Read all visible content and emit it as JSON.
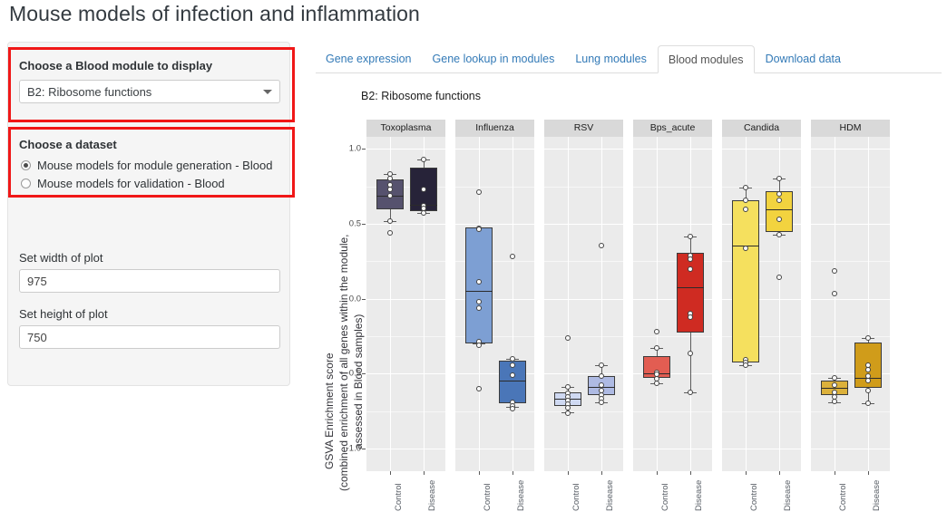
{
  "page": {
    "title": "Mouse models of infection and inflammation"
  },
  "sidebar": {
    "module_label": "Choose a Blood module to display",
    "module_selected": "B2: Ribosome functions",
    "dataset_label": "Choose a dataset",
    "dataset_options": [
      {
        "label": "Mouse models for module generation - Blood",
        "checked": true
      },
      {
        "label": "Mouse models for validation - Blood",
        "checked": false
      }
    ],
    "width_label": "Set width of plot",
    "width_value": "975",
    "height_label": "Set height of plot",
    "height_value": "750",
    "highlight_color": "#f01717"
  },
  "tabs": [
    {
      "label": "Gene expression",
      "active": false
    },
    {
      "label": "Gene lookup in modules",
      "active": false
    },
    {
      "label": "Lung modules",
      "active": false
    },
    {
      "label": "Blood modules",
      "active": true
    },
    {
      "label": "Download data",
      "active": false
    }
  ],
  "chart_data": {
    "type": "box",
    "title": "B2: Ribosome functions",
    "ylabel": "GSVA Enrichment score",
    "ylabel2": "(combined enrichment of all genes within the module,",
    "ylabel3": "assessed in Blood samples)",
    "xlabel": "",
    "ylim": [
      -1.15,
      1.08
    ],
    "yticks": [
      1.0,
      0.5,
      0.0,
      -0.5,
      -1.0
    ],
    "ytick_labels": [
      "1.0",
      "0.5",
      "0.0",
      "-0.5",
      "-1.0"
    ],
    "grid": true,
    "legend": "none",
    "groups": [
      "Control",
      "Disease"
    ],
    "panels": [
      {
        "name": "Toxoplasma",
        "boxes": [
          {
            "group": "Control",
            "fill": "#56526e",
            "q1": 0.595,
            "median": 0.685,
            "q3": 0.795,
            "lower_whisker": 0.52,
            "upper_whisker": 0.83,
            "points": [
              0.83,
              0.8,
              0.76,
              0.73,
              0.685,
              0.52,
              0.44
            ]
          },
          {
            "group": "Disease",
            "fill": "#272339",
            "q1": 0.585,
            "median": 0.625,
            "q3": 0.875,
            "lower_whisker": 0.57,
            "upper_whisker": 0.93,
            "points": [
              0.93,
              0.73,
              0.62,
              0.6,
              0.57
            ]
          }
        ]
      },
      {
        "name": "Influenza",
        "boxes": [
          {
            "group": "Control",
            "fill": "#7d9fd3",
            "q1": -0.295,
            "median": 0.055,
            "q3": 0.475,
            "lower_whisker": -0.3,
            "upper_whisker": 0.475,
            "points": [
              0.71,
              0.47,
              0.465,
              0.115,
              -0.02,
              -0.06,
              -0.285,
              -0.31,
              -0.6
            ]
          },
          {
            "group": "Disease",
            "fill": "#4a76b8",
            "q1": -0.695,
            "median": -0.545,
            "q3": -0.415,
            "lower_whisker": -0.72,
            "upper_whisker": -0.4,
            "points": [
              0.285,
              -0.4,
              -0.44,
              -0.51,
              -0.69,
              -0.715,
              -0.73
            ]
          }
        ]
      },
      {
        "name": "RSV",
        "boxes": [
          {
            "group": "Control",
            "fill": "#cfd9f2",
            "q1": -0.715,
            "median": -0.665,
            "q3": -0.625,
            "lower_whisker": -0.76,
            "upper_whisker": -0.59,
            "points": [
              -0.26,
              -0.59,
              -0.63,
              -0.655,
              -0.68,
              -0.7,
              -0.725,
              -0.765
            ]
          },
          {
            "group": "Disease",
            "fill": "#aebae3",
            "q1": -0.645,
            "median": -0.585,
            "q3": -0.515,
            "lower_whisker": -0.69,
            "upper_whisker": -0.445,
            "points": [
              0.355,
              -0.445,
              -0.515,
              -0.575,
              -0.615,
              -0.64,
              -0.665,
              -0.69
            ]
          }
        ]
      },
      {
        "name": "Bps_acute",
        "boxes": [
          {
            "group": "Control",
            "fill": "#e25d52",
            "q1": -0.525,
            "median": -0.495,
            "q3": -0.385,
            "lower_whisker": -0.565,
            "upper_whisker": -0.33,
            "points": [
              -0.22,
              -0.33,
              -0.49,
              -0.505,
              -0.535,
              -0.565
            ]
          },
          {
            "group": "Disease",
            "fill": "#cf2b22",
            "q1": -0.225,
            "median": 0.075,
            "q3": 0.305,
            "lower_whisker": -0.625,
            "upper_whisker": 0.415,
            "points": [
              0.415,
              0.29,
              0.265,
              0.195,
              -0.1,
              -0.12,
              -0.365,
              -0.625
            ]
          }
        ]
      },
      {
        "name": "Candida",
        "boxes": [
          {
            "group": "Control",
            "fill": "#f5e05e",
            "q1": -0.425,
            "median": 0.355,
            "q3": 0.655,
            "lower_whisker": -0.445,
            "upper_whisker": 0.74,
            "points": [
              0.74,
              0.655,
              0.595,
              0.335,
              -0.405,
              -0.425,
              -0.445
            ]
          },
          {
            "group": "Disease",
            "fill": "#f2d33f",
            "q1": 0.445,
            "median": 0.595,
            "q3": 0.72,
            "lower_whisker": 0.425,
            "upper_whisker": 0.8,
            "points": [
              0.8,
              0.7,
              0.655,
              0.53,
              0.425,
              0.145
            ]
          }
        ]
      },
      {
        "name": "HDM",
        "boxes": [
          {
            "group": "Control",
            "fill": "#dcb13b",
            "q1": -0.645,
            "median": -0.595,
            "q3": -0.545,
            "lower_whisker": -0.69,
            "upper_whisker": -0.53,
            "points": [
              0.185,
              0.035,
              -0.53,
              -0.575,
              -0.625,
              -0.655,
              -0.685
            ]
          },
          {
            "group": "Disease",
            "fill": "#d09c1a",
            "q1": -0.595,
            "median": -0.525,
            "q3": -0.29,
            "lower_whisker": -0.695,
            "upper_whisker": -0.26,
            "points": [
              -0.26,
              -0.445,
              -0.475,
              -0.515,
              -0.545,
              -0.615,
              -0.695
            ]
          }
        ]
      }
    ]
  }
}
